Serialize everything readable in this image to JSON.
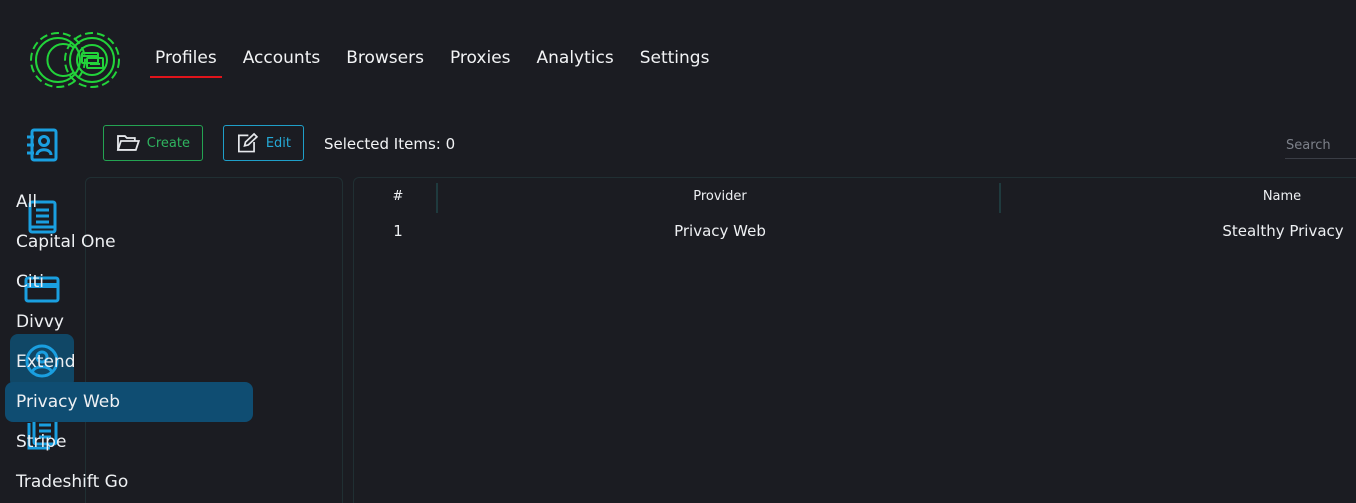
{
  "nav": {
    "tabs": [
      {
        "label": "Profiles",
        "active": true
      },
      {
        "label": "Accounts"
      },
      {
        "label": "Browsers"
      },
      {
        "label": "Proxies"
      },
      {
        "label": "Analytics"
      },
      {
        "label": "Settings"
      }
    ]
  },
  "rail": {
    "items": [
      {
        "icon": "address-book-icon"
      },
      {
        "icon": "book-icon"
      },
      {
        "icon": "credit-card-icon"
      },
      {
        "icon": "user-circle-icon",
        "active": true
      },
      {
        "icon": "documents-icon"
      }
    ]
  },
  "toolbar": {
    "create_label": "Create",
    "edit_label": "Edit",
    "selected_items": "Selected Items: 0",
    "search_placeholder": "Search"
  },
  "providers": {
    "items": [
      "All",
      "Capital One",
      "Citi",
      "Divvy",
      "Extend",
      "Privacy Web",
      "Stripe",
      "Tradeshift Go"
    ],
    "selected": "Privacy Web"
  },
  "table": {
    "columns": [
      "#",
      "Provider",
      "Name"
    ],
    "rows": [
      {
        "index": "1",
        "provider": "Privacy Web",
        "name": "Stealthy Privacy"
      }
    ]
  },
  "colors": {
    "background": "#1b1c22",
    "accent_blue": "#1a9fe0",
    "logo_green": "#22d33a",
    "active_underline": "#e0141b",
    "selected_bg": "#0f4d72",
    "create_green": "#2fb35f",
    "edit_blue": "#25a9d6"
  }
}
